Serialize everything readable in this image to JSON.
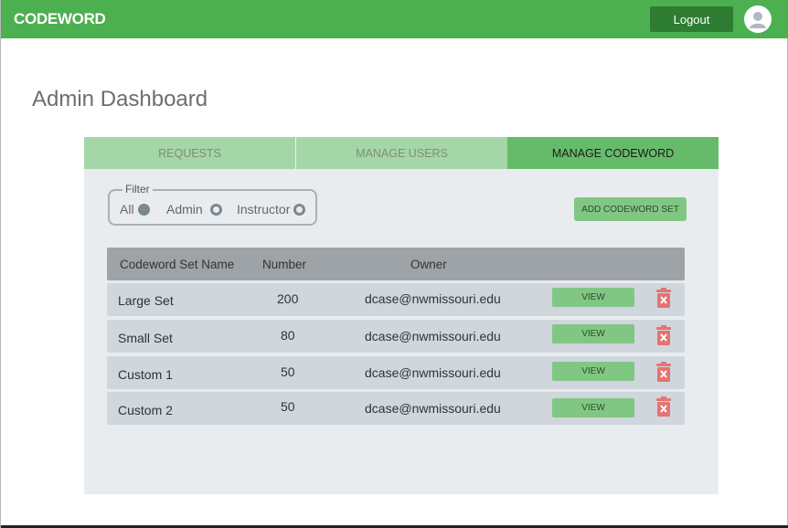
{
  "header": {
    "brand": "CODEWORD",
    "logout_label": "Logout",
    "bar_color": "#4caf50"
  },
  "page": {
    "title": "Admin Dashboard"
  },
  "tabs": [
    {
      "label": "REQUESTS",
      "active": false
    },
    {
      "label": "MANAGE USERS",
      "active": false
    },
    {
      "label": "MANAGE CODEWORD",
      "active": true
    }
  ],
  "filter": {
    "legend": "Filter",
    "options": [
      {
        "label": "All",
        "selected": true
      },
      {
        "label": "Admin",
        "selected": false
      },
      {
        "label": "Instructor",
        "selected": false
      }
    ]
  },
  "actions": {
    "add_label": "ADD CODEWORD SET"
  },
  "table": {
    "headers": {
      "name": "Codeword Set Name",
      "number": "Number",
      "owner": "Owner"
    },
    "view_label": "VIEW",
    "rows": [
      {
        "name": "Large Set",
        "number": "200",
        "owner": "dcase@nwmissouri.edu"
      },
      {
        "name": "Small Set",
        "number": "80",
        "owner": "dcase@nwmissouri.edu"
      },
      {
        "name": "Custom 1",
        "number": "50",
        "owner": "dcase@nwmissouri.edu"
      },
      {
        "name": "Custom 2",
        "number": "50",
        "owner": "dcase@nwmissouri.edu"
      }
    ]
  },
  "icons": {
    "avatar": "user-avatar-icon",
    "delete": "trash-icon",
    "delete_color": "#e57373"
  }
}
